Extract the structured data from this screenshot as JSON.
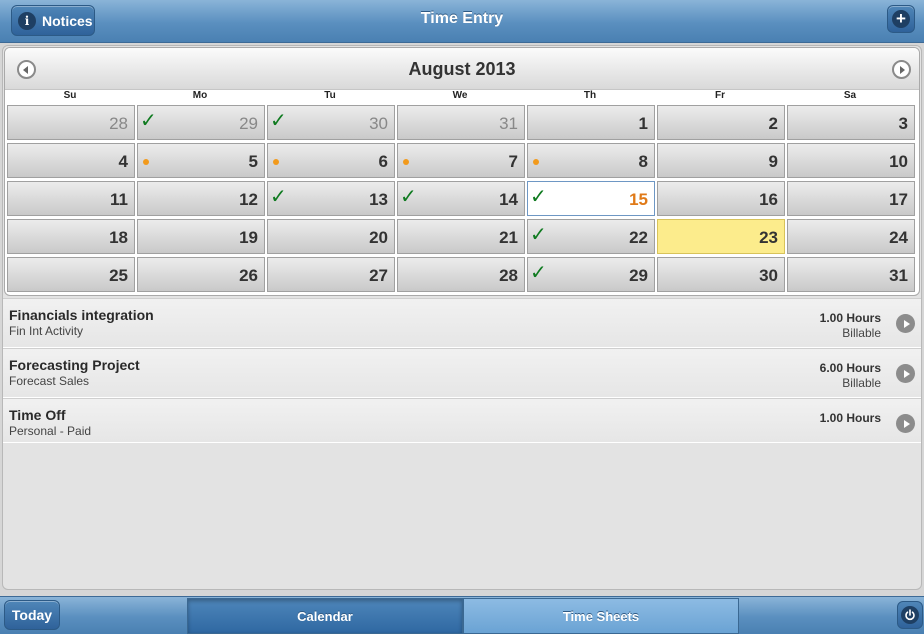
{
  "header": {
    "title": "Time Entry",
    "notices_label": "Notices",
    "info_icon": "i",
    "add_icon": "+"
  },
  "calendar": {
    "month_title": "August 2013",
    "weekdays": [
      "Su",
      "Mo",
      "Tu",
      "We",
      "Th",
      "Fr",
      "Sa"
    ],
    "weeks": [
      [
        {
          "day": "28",
          "other": true
        },
        {
          "day": "29",
          "other": true,
          "mark": "check"
        },
        {
          "day": "30",
          "other": true,
          "mark": "check"
        },
        {
          "day": "31",
          "other": true
        },
        {
          "day": "1"
        },
        {
          "day": "2"
        },
        {
          "day": "3"
        }
      ],
      [
        {
          "day": "4"
        },
        {
          "day": "5",
          "mark": "dot"
        },
        {
          "day": "6",
          "mark": "dot"
        },
        {
          "day": "7",
          "mark": "dot"
        },
        {
          "day": "8",
          "mark": "dot"
        },
        {
          "day": "9"
        },
        {
          "day": "10"
        }
      ],
      [
        {
          "day": "11"
        },
        {
          "day": "12"
        },
        {
          "day": "13",
          "mark": "check"
        },
        {
          "day": "14",
          "mark": "check"
        },
        {
          "day": "15",
          "mark": "check",
          "state": "today"
        },
        {
          "day": "16"
        },
        {
          "day": "17"
        }
      ],
      [
        {
          "day": "18"
        },
        {
          "day": "19"
        },
        {
          "day": "20"
        },
        {
          "day": "21"
        },
        {
          "day": "22",
          "mark": "check"
        },
        {
          "day": "23",
          "state": "selected"
        },
        {
          "day": "24"
        }
      ],
      [
        {
          "day": "25"
        },
        {
          "day": "26"
        },
        {
          "day": "27"
        },
        {
          "day": "28"
        },
        {
          "day": "29",
          "mark": "check"
        },
        {
          "day": "30"
        },
        {
          "day": "31"
        }
      ]
    ],
    "check_glyph": "✓"
  },
  "entries": [
    {
      "title": "Financials integration",
      "subtitle": "Fin Int Activity",
      "hours": "1.00 Hours",
      "billing": "Billable"
    },
    {
      "title": "Forecasting Project",
      "subtitle": "Forecast Sales",
      "hours": "6.00 Hours",
      "billing": "Billable"
    },
    {
      "title": "Time Off",
      "subtitle": "Personal - Paid",
      "hours": "1.00 Hours",
      "billing": ""
    }
  ],
  "footer": {
    "today_label": "Today",
    "tab_calendar": "Calendar",
    "tab_timesheets": "Time Sheets"
  },
  "colors": {
    "header_blue": "#5a8fbf",
    "today_text": "#e07a18",
    "selected_bg": "#fcec8c",
    "check_green": "#0e7a1f",
    "dot_orange": "#f29a1b"
  }
}
